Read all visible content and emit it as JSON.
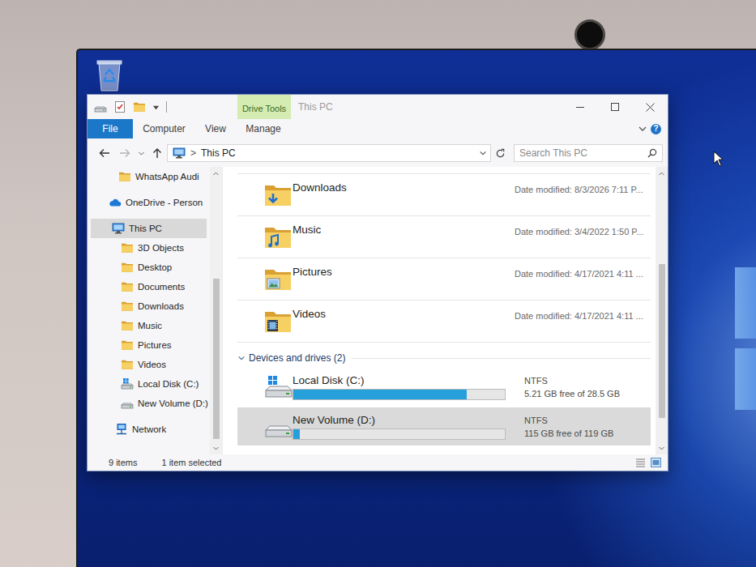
{
  "window": {
    "title": "This PC",
    "context_tab": "Drive Tools"
  },
  "ribbon": {
    "tabs": [
      {
        "label": "File",
        "kind": "file",
        "selected": false
      },
      {
        "label": "Computer",
        "kind": "tab",
        "selected": false
      },
      {
        "label": "View",
        "kind": "tab",
        "selected": false
      },
      {
        "label": "Manage",
        "kind": "context",
        "selected": false
      }
    ],
    "help": "?"
  },
  "address": {
    "separator": ">",
    "path": "This PC",
    "back_enabled": true,
    "forward_enabled": false
  },
  "search": {
    "placeholder": "Search This PC"
  },
  "sidebar": {
    "items": [
      {
        "label": "WhatsApp Audi",
        "kind": "pinned",
        "selected": false
      },
      {
        "label": "OneDrive - Person",
        "kind": "cloud",
        "selected": false
      },
      {
        "label": "This PC",
        "kind": "pc",
        "selected": true
      },
      {
        "label": "3D Objects",
        "kind": "folder",
        "selected": false
      },
      {
        "label": "Desktop",
        "kind": "folder",
        "selected": false
      },
      {
        "label": "Documents",
        "kind": "folder",
        "selected": false
      },
      {
        "label": "Downloads",
        "kind": "folder",
        "selected": false
      },
      {
        "label": "Music",
        "kind": "folder",
        "selected": false
      },
      {
        "label": "Pictures",
        "kind": "folder",
        "selected": false
      },
      {
        "label": "Videos",
        "kind": "folder",
        "selected": false
      },
      {
        "label": "Local Disk (C:)",
        "kind": "sysdrive",
        "selected": false
      },
      {
        "label": "New Volume (D:)",
        "kind": "drive",
        "selected": false
      },
      {
        "label": "Network",
        "kind": "network",
        "selected": false
      }
    ]
  },
  "content": {
    "folders": [
      {
        "name": "Downloads",
        "modified": "Date modified: 8/3/2026 7:11 P...",
        "kind": "downloads"
      },
      {
        "name": "Music",
        "modified": "Date modified: 3/4/2022 1:50 P...",
        "kind": "music"
      },
      {
        "name": "Pictures",
        "modified": "Date modified: 4/17/2021 4:11 ...",
        "kind": "pictures"
      },
      {
        "name": "Videos",
        "modified": "Date modified: 4/17/2021 4:11 ...",
        "kind": "videos"
      }
    ],
    "group": {
      "label": "Devices and drives (2)",
      "expanded": true
    },
    "drives": [
      {
        "name": "Local Disk (C:)",
        "filesystem": "NTFS",
        "space": "5.21 GB free of 28.5 GB",
        "level": 0.82,
        "selected": false,
        "kind": "system"
      },
      {
        "name": "New Volume (D:)",
        "filesystem": "NTFS",
        "space": "115 GB free of 119 GB",
        "level": 0.03,
        "selected": true,
        "kind": "data"
      }
    ]
  },
  "status_bar": {
    "count": "9 items",
    "selection": "1 item selected"
  }
}
